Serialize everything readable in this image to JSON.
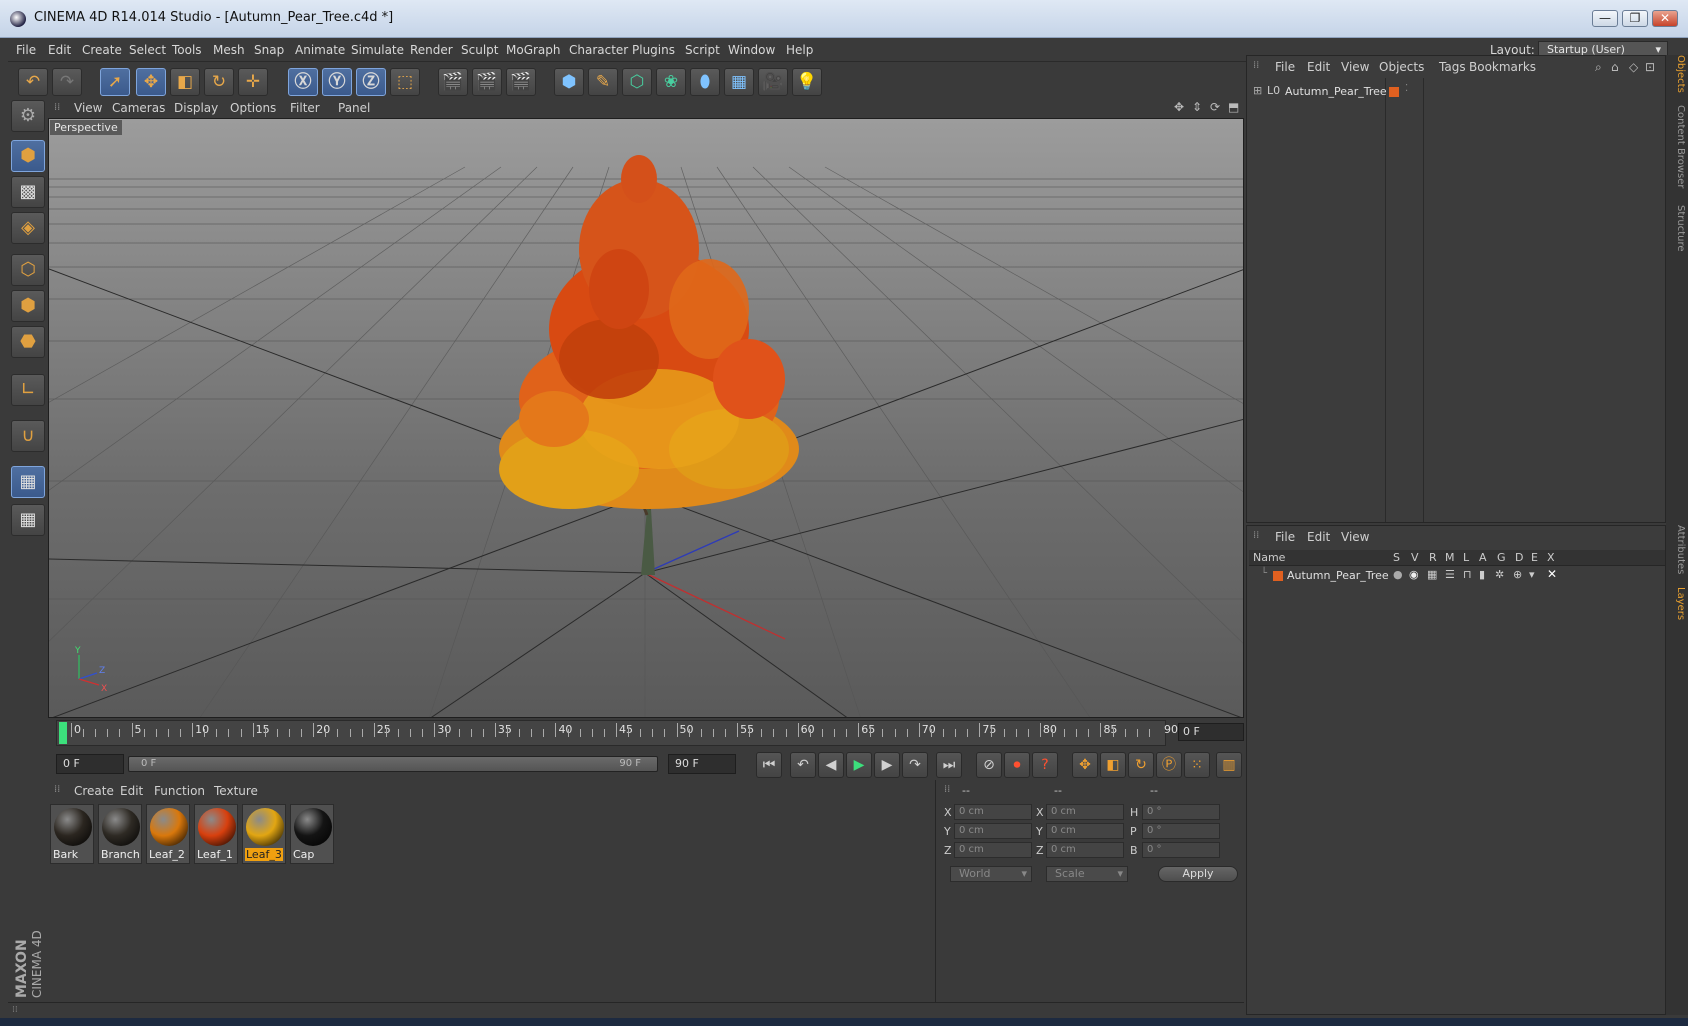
{
  "window": {
    "title": "CINEMA 4D R14.014 Studio - [Autumn_Pear_Tree.c4d *]",
    "minimize": "—",
    "restore": "❐",
    "close": "✕"
  },
  "menubar": {
    "items": [
      "File",
      "Edit",
      "Create",
      "Select",
      "Tools",
      "Mesh",
      "Snap",
      "Animate",
      "Simulate",
      "Render",
      "Sculpt",
      "MoGraph",
      "Character",
      "Plugins",
      "Script",
      "Window",
      "Help"
    ],
    "layout_label": "Layout:",
    "layout_value": "Startup (User)"
  },
  "viewport": {
    "menu": [
      "View",
      "Cameras",
      "Display",
      "Options",
      "Filter",
      "Panel"
    ],
    "label": "Perspective",
    "axis_labels": [
      "Y",
      "Z",
      "X"
    ]
  },
  "timeline": {
    "ticks": [
      "0",
      "5",
      "10",
      "15",
      "20",
      "25",
      "30",
      "35",
      "40",
      "45",
      "50",
      "55",
      "60",
      "65",
      "70",
      "75",
      "80",
      "85",
      "90"
    ],
    "current_frame": "0 F",
    "start_frame": "0 F",
    "range_start": "0 F",
    "range_end": "90 F",
    "end_frame": "90 F"
  },
  "materials": {
    "menu": [
      "Create",
      "Edit",
      "Function",
      "Texture"
    ],
    "items": [
      {
        "name": "Bark",
        "color": "#2b2620"
      },
      {
        "name": "Branch",
        "color": "#2e2a24"
      },
      {
        "name": "Leaf_2",
        "color": "#d9780c"
      },
      {
        "name": "Leaf_1",
        "color": "#d8400e"
      },
      {
        "name": "Leaf_3",
        "color": "#e2a612"
      },
      {
        "name": "Cap",
        "color": "#141414"
      }
    ],
    "selected": "Leaf_3"
  },
  "coordinates": {
    "headers": [
      "--",
      "--",
      "--"
    ],
    "rows": [
      {
        "a": "X",
        "av": "0 cm",
        "b": "X",
        "bv": "0 cm",
        "c": "H",
        "cv": "0 °"
      },
      {
        "a": "Y",
        "av": "0 cm",
        "b": "Y",
        "bv": "0 cm",
        "c": "P",
        "cv": "0 °"
      },
      {
        "a": "Z",
        "av": "0 cm",
        "b": "Z",
        "bv": "0 cm",
        "c": "B",
        "cv": "0 °"
      }
    ],
    "space": "World",
    "mode": "Scale",
    "apply": "Apply"
  },
  "objects": {
    "menu": [
      "File",
      "Edit",
      "View",
      "Objects",
      "Tags",
      "Bookmarks"
    ],
    "tree": [
      {
        "name": "Autumn_Pear_Tree"
      }
    ]
  },
  "layers": {
    "menu": [
      "File",
      "Edit",
      "View"
    ],
    "columns": [
      "Name",
      "S",
      "V",
      "R",
      "M",
      "L",
      "A",
      "G",
      "D",
      "E",
      "X"
    ],
    "rows": [
      {
        "name": "Autumn_Pear_Tree",
        "color": "#e06020"
      }
    ]
  },
  "side_tabs": [
    "Objects",
    "Content Browser",
    "Structure",
    "Attributes",
    "Layers"
  ],
  "brand": {
    "line1": "MAXON",
    "line2": "CINEMA 4D"
  },
  "colors": {
    "accent": "#e8a030",
    "selection": "#4f6fa0",
    "play": "#3ce07c"
  }
}
